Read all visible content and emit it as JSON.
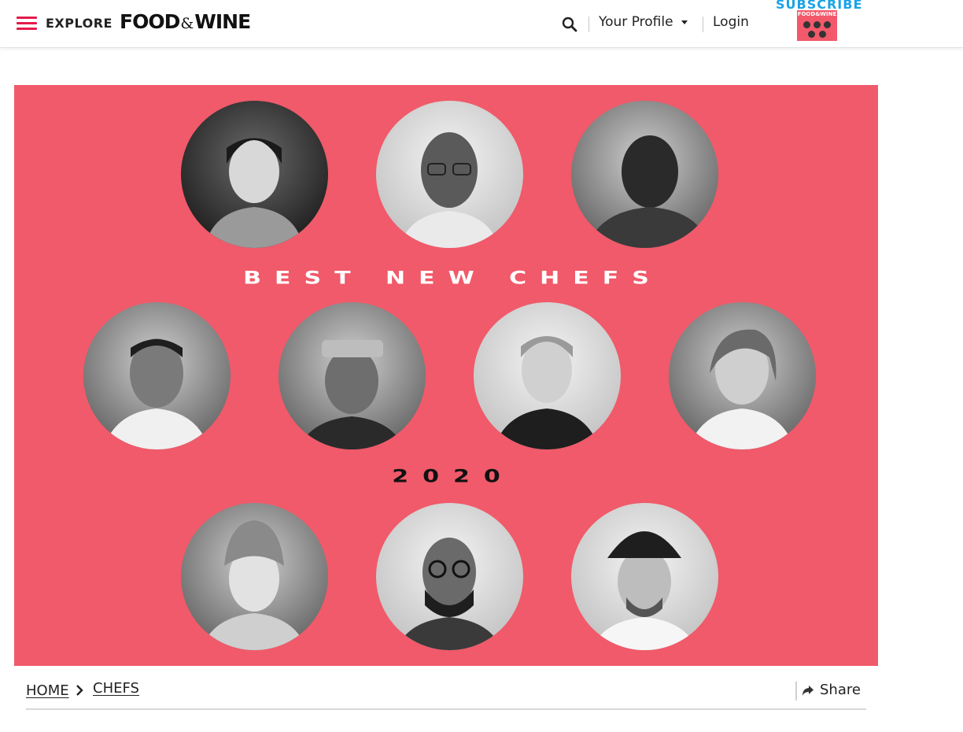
{
  "header": {
    "menu_icon": "hamburger-menu-icon",
    "explore_label": "EXPLORE",
    "logo_left": "FOOD",
    "logo_amp": "&",
    "logo_right": "WINE",
    "search_icon": "search-icon",
    "profile_label": "Your Profile",
    "login_label": "Login",
    "subscribe_label": "SUBSCRIBE",
    "magazine_cover_title": "FOOD&WINE",
    "accent_color": "#e41b4a",
    "subscribe_color": "#1aa3e8"
  },
  "hero": {
    "background_color": "#f05a6a",
    "headline": "BEST NEW CHEFS",
    "year": "2020",
    "portrait_count": 10
  },
  "breadcrumb": {
    "items": [
      {
        "label": "HOME"
      },
      {
        "label": "CHEFS"
      }
    ],
    "separator_icon": "chevron-right-icon"
  },
  "share": {
    "label": "Share",
    "icon": "share-arrow-icon"
  }
}
